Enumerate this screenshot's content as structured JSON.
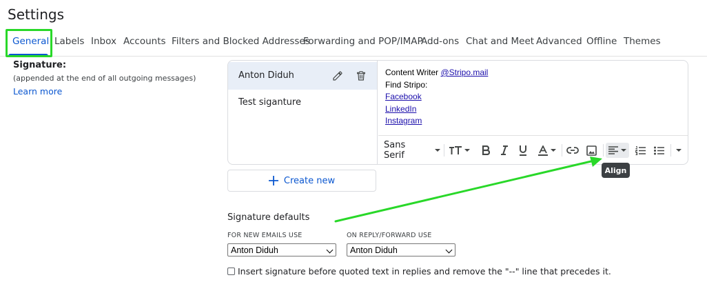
{
  "page": {
    "title": "Settings"
  },
  "tabs": [
    {
      "label": "General",
      "active": true
    },
    {
      "label": "Labels"
    },
    {
      "label": "Inbox"
    },
    {
      "label": "Accounts"
    },
    {
      "label": "Filters and Blocked Addresses"
    },
    {
      "label": "Forwarding and POP/IMAP"
    },
    {
      "label": "Add-ons"
    },
    {
      "label": "Chat and Meet"
    },
    {
      "label": "Advanced"
    },
    {
      "label": "Offline"
    },
    {
      "label": "Themes"
    }
  ],
  "signature": {
    "label": "Signature:",
    "note": "(appended at the end of all outgoing messages)",
    "learn_more": "Learn more",
    "items": [
      {
        "name": "Anton Diduh",
        "selected": true
      },
      {
        "name": "Test siganture"
      }
    ],
    "create_new": "Create new"
  },
  "editor": {
    "line1_prefix": "Content Writer ",
    "line1_link": "@Stripo.mail",
    "line2": "Find Stripo:",
    "links": [
      "Facebook",
      "LinkedIn",
      "Instagram"
    ],
    "font_name": "Sans Serif"
  },
  "tooltip": {
    "label": "Align"
  },
  "defaults": {
    "title": "Signature defaults",
    "new_emails_label": "FOR NEW EMAILS USE",
    "new_emails_value": "Anton Diduh",
    "reply_label": "ON REPLY/FORWARD USE",
    "reply_value": "Anton Diduh"
  },
  "checkbox": {
    "label": "Insert signature before quoted text in replies and remove the \"--\" line that precedes it.",
    "checked": false
  },
  "colors": {
    "accent": "#0b57d0",
    "highlight": "#29d829",
    "selected_bg": "#e8eef7"
  }
}
